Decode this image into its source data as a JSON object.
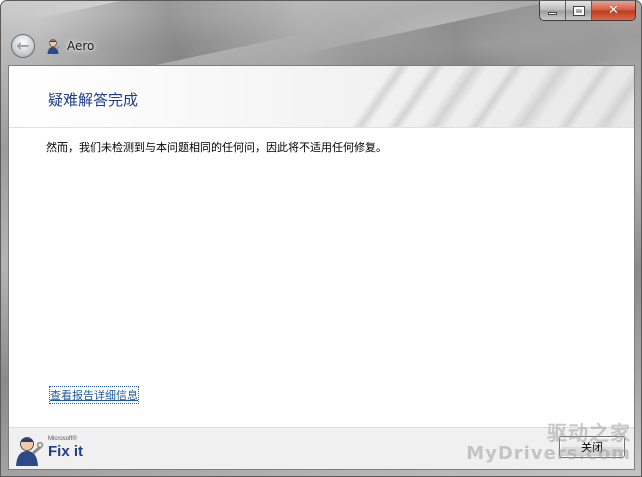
{
  "window": {
    "app_title": "Aero",
    "caption_buttons": {
      "minimize": "minimize",
      "maximize": "maximize",
      "close": "✕"
    }
  },
  "content": {
    "page_title": "疑难解答完成",
    "message": "然而，我们未检测到与本问题相同的任何问，因此将不适用任何修复。",
    "report_link": "查看报告详细信息"
  },
  "footer": {
    "brand_small": "Microsoft®",
    "brand_big": "Fix it",
    "close_button": "关闭"
  },
  "watermark": {
    "line1": "驱动之家",
    "line2": "MyDrivers.com"
  },
  "colors": {
    "title_blue": "#1f3d8c",
    "link_blue": "#1c5a9b",
    "close_red": "#c0391b"
  },
  "icons": [
    "back-arrow-icon",
    "fixit-mechanic-icon",
    "minimize-icon",
    "maximize-icon",
    "close-icon"
  ]
}
